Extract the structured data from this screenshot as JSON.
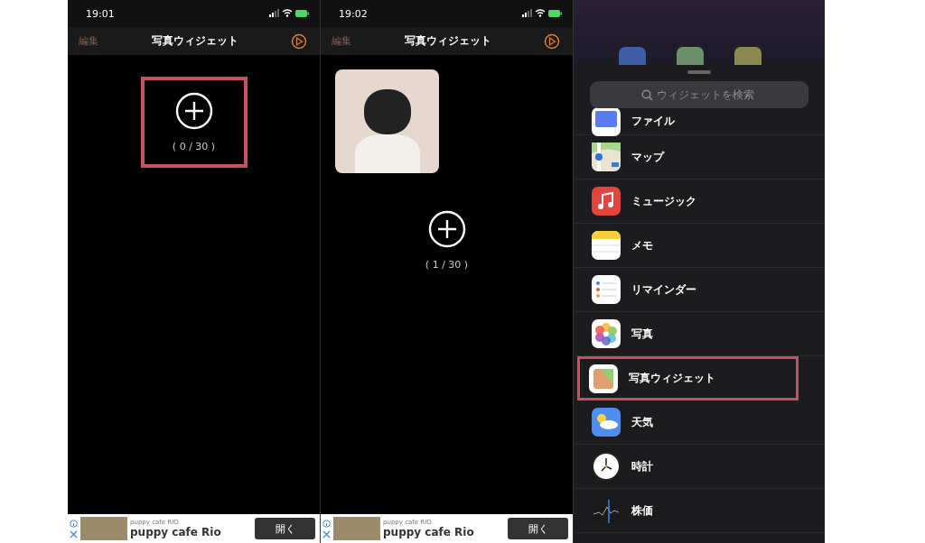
{
  "screens": [
    {
      "kind": "app",
      "time": "19:01",
      "nav": {
        "edit": "編集",
        "title": "写真ウィジェット"
      },
      "has_photo": false,
      "add": {
        "count": "( 0 / 30 )",
        "highlighted": true
      },
      "ad": {
        "advertiser": "puppy cafe RIO",
        "title": "puppy cafe Rio",
        "button": "開く"
      }
    },
    {
      "kind": "app",
      "time": "19:02",
      "nav": {
        "edit": "編集",
        "title": "写真ウィジェット"
      },
      "has_photo": true,
      "add": {
        "count": "( 1 / 30 )",
        "highlighted": false
      },
      "ad": {
        "advertiser": "puppy cafe RIO",
        "title": "puppy cafe Rio",
        "button": "開く"
      }
    },
    {
      "kind": "widget_picker",
      "search": {
        "placeholder": "ウィジェットを検索"
      },
      "apps": [
        {
          "name": "ファイル",
          "highlighted": false
        },
        {
          "name": "マップ",
          "highlighted": false
        },
        {
          "name": "ミュージック",
          "highlighted": false
        },
        {
          "name": "メモ",
          "highlighted": false
        },
        {
          "name": "リマインダー",
          "highlighted": false
        },
        {
          "name": "写真",
          "highlighted": false
        },
        {
          "name": "写真ウィジェット",
          "highlighted": true
        },
        {
          "name": "天気",
          "highlighted": false
        },
        {
          "name": "時計",
          "highlighted": false
        },
        {
          "name": "株価",
          "highlighted": false
        }
      ]
    }
  ]
}
